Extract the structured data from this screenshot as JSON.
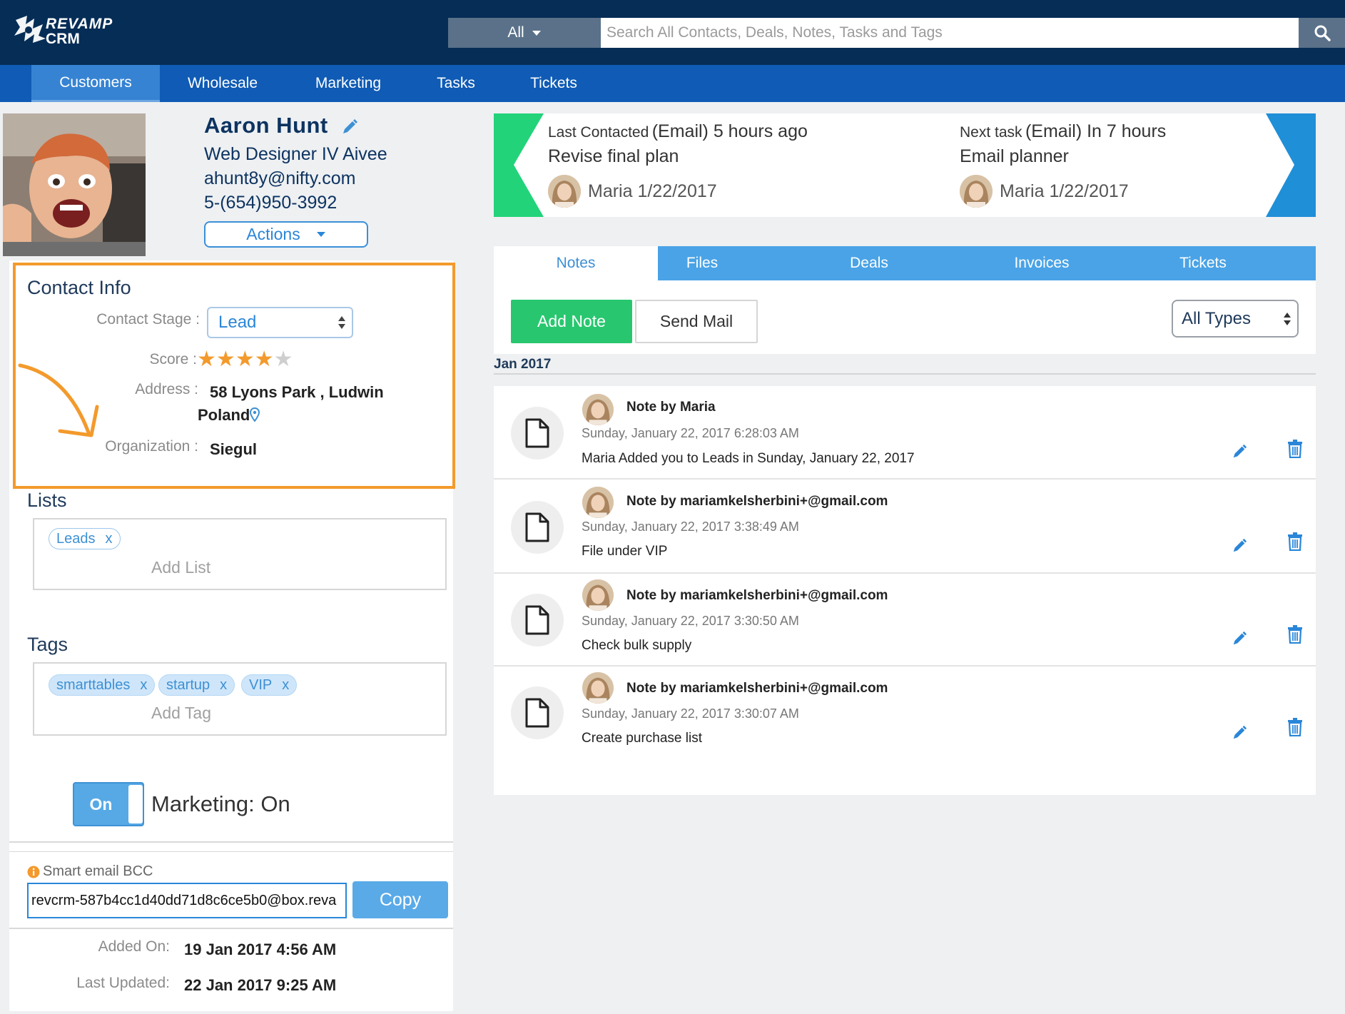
{
  "header": {
    "logo_line1": "REVAMP",
    "logo_line2": "CRM",
    "search_scope": "All",
    "search_placeholder": "Search All Contacts, Deals, Notes, Tasks and Tags"
  },
  "nav": {
    "items": [
      {
        "label": "Customers",
        "active": true
      },
      {
        "label": "Wholesale"
      },
      {
        "label": "Marketing"
      },
      {
        "label": "Tasks"
      },
      {
        "label": "Tickets"
      }
    ]
  },
  "contact": {
    "name": "Aaron Hunt",
    "title": "Web Designer IV Aivee",
    "email": "ahunt8y@nifty.com",
    "phone": "5-(654)950-3992",
    "actions_label": "Actions"
  },
  "contact_info": {
    "heading": "Contact Info",
    "stage_label": "Contact Stage :",
    "stage_value": "Lead",
    "score_label": "Score :",
    "score": 4,
    "score_max": 5,
    "address_label": "Address :",
    "address_line1": "58 Lyons Park , Ludwin",
    "address_line2": "Poland",
    "org_label": "Organization :",
    "org_value": "Siegul"
  },
  "lists": {
    "heading": "Lists",
    "items": [
      "Leads"
    ],
    "remove_glyph": "x",
    "add_placeholder": "Add List"
  },
  "tags": {
    "heading": "Tags",
    "items": [
      "smarttables",
      "startup",
      "VIP"
    ],
    "remove_glyph": "x",
    "add_placeholder": "Add Tag"
  },
  "marketing": {
    "toggle_label": "On",
    "status_text": "Marketing: On"
  },
  "bcc": {
    "label": "Smart email BCC",
    "value": "revcrm-587b4cc1d40dd71d8c6ce5b0@box.reva",
    "copy_label": "Copy"
  },
  "meta": {
    "added_label": "Added On:",
    "added_value": "19 Jan 2017 4:56 AM",
    "updated_label": "Last Updated:",
    "updated_value": "22 Jan 2017 9:25 AM"
  },
  "activity": {
    "last": {
      "prefix": "Last Contacted",
      "detail": "(Email) 5 hours ago",
      "title": "Revise final plan",
      "by": "Maria 1/22/2017"
    },
    "next": {
      "prefix": "Next task",
      "detail": "(Email) In 7 hours",
      "title": "Email planner",
      "by": "Maria 1/22/2017"
    }
  },
  "tabs": [
    {
      "label": "Notes",
      "active": true
    },
    {
      "label": "Files"
    },
    {
      "label": "Deals"
    },
    {
      "label": "Invoices"
    },
    {
      "label": "Tickets"
    }
  ],
  "notes_toolbar": {
    "add_note": "Add Note",
    "send_mail": "Send Mail",
    "filter": "All Types"
  },
  "notes_month": "Jan 2017",
  "notes": [
    {
      "title": "Note by Maria",
      "date": "Sunday, January 22, 2017 6:28:03 AM",
      "text": "Maria Added you to Leads in Sunday, January 22, 2017"
    },
    {
      "title": "Note by mariamkelsherbini+@gmail.com",
      "date": "Sunday, January 22, 2017 3:38:49 AM",
      "text": "File under VIP"
    },
    {
      "title": "Note by mariamkelsherbini+@gmail.com",
      "date": "Sunday, January 22, 2017 3:30:50 AM",
      "text": "Check bulk supply"
    },
    {
      "title": "Note by mariamkelsherbini+@gmail.com",
      "date": "Sunday, January 22, 2017 3:30:07 AM",
      "text": "Create purchase list"
    }
  ],
  "colors": {
    "header_bg": "#062d56",
    "nav_bg": "#0f5bb5",
    "accent": "#2a86d8",
    "highlight_border": "#f39a2c",
    "add_note_green": "#28c76f",
    "star_on": "#f39a2c",
    "star_off": "#cfcfcf"
  },
  "icons": [
    "logo-icon",
    "chevron-down-icon",
    "search-icon",
    "pencil-icon",
    "map-pin-icon",
    "star-icon",
    "info-icon",
    "document-icon",
    "trash-icon",
    "updown-arrows-icon",
    "curved-arrow-annotation"
  ]
}
